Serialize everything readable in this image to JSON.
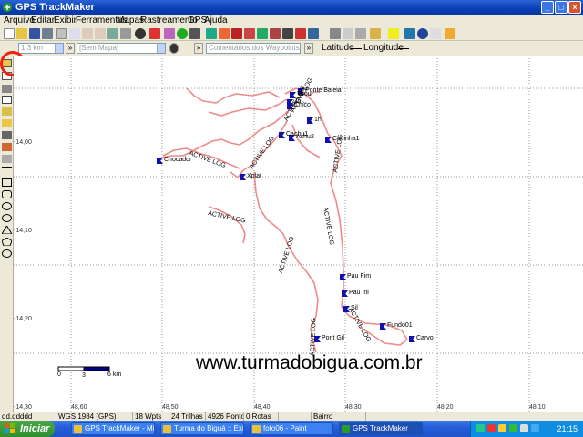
{
  "window": {
    "title": "GPS TrackMaker",
    "min": "_",
    "max": "□",
    "close": "×"
  },
  "menu": [
    "Arquivo",
    "Editar",
    "Exibir",
    "Ferramentas",
    "Mapas",
    "Rastreamento",
    "GPS",
    "Ajuda"
  ],
  "toolbar2": {
    "scale_value": "1:3 km",
    "map_value": "[Sem Mapa]",
    "comment_placeholder": "Comentários dos Waypoints",
    "go": "»",
    "latitude_label": "Latitude",
    "longitude_label": "Longitude"
  },
  "map": {
    "y_ticks": [
      "-14,00",
      "-14,10",
      "-14,20",
      "-14,30"
    ],
    "x_ticks": [
      "48,60",
      "48,50",
      "48,40",
      "48,30",
      "48,20",
      "48,10"
    ],
    "waypoints": [
      "Ponte Baleia",
      "Tirou",
      "Ju...",
      "Chico",
      "1h",
      "Cacinha1",
      "Achu2",
      "Cachu1",
      "Chocador",
      "Xplat",
      "Pau Fim",
      "Pau Ini",
      "Sil",
      "Fundo01",
      "Carvo",
      "Pont Gil"
    ],
    "track_labels": [
      "ACTIVE LOG",
      "ACTIVE LOG",
      "ACTIVE LOG",
      "ACTIVE LOG",
      "ACTIVE LOG",
      "ACTIVE LOG",
      "ACTIVE LOG",
      "ACTIVE LOG",
      "ACTIVE LOG",
      "ACTIVE LOG"
    ],
    "scale_bar": {
      "start": "0",
      "mid": "3",
      "end": "6 km"
    },
    "watermark": "www.turmadobigua.com.br",
    "track_color": "#ee8a8a",
    "waypoint_color": "#1010b0"
  },
  "status": [
    "dd.ddddd",
    "WGS 1984 (GPS)",
    "18 Wpts",
    "24 Trilhas",
    "4926 Pontos",
    "0 Rotas",
    "",
    "Bairro"
  ],
  "taskbar": {
    "start": "Iniciar",
    "tasks": [
      "GPS TrackMaker - Mic...",
      "Turma do Biguá :: Exi...",
      "foto06 - Paint",
      "GPS TrackMaker"
    ],
    "clock": "21:15"
  }
}
